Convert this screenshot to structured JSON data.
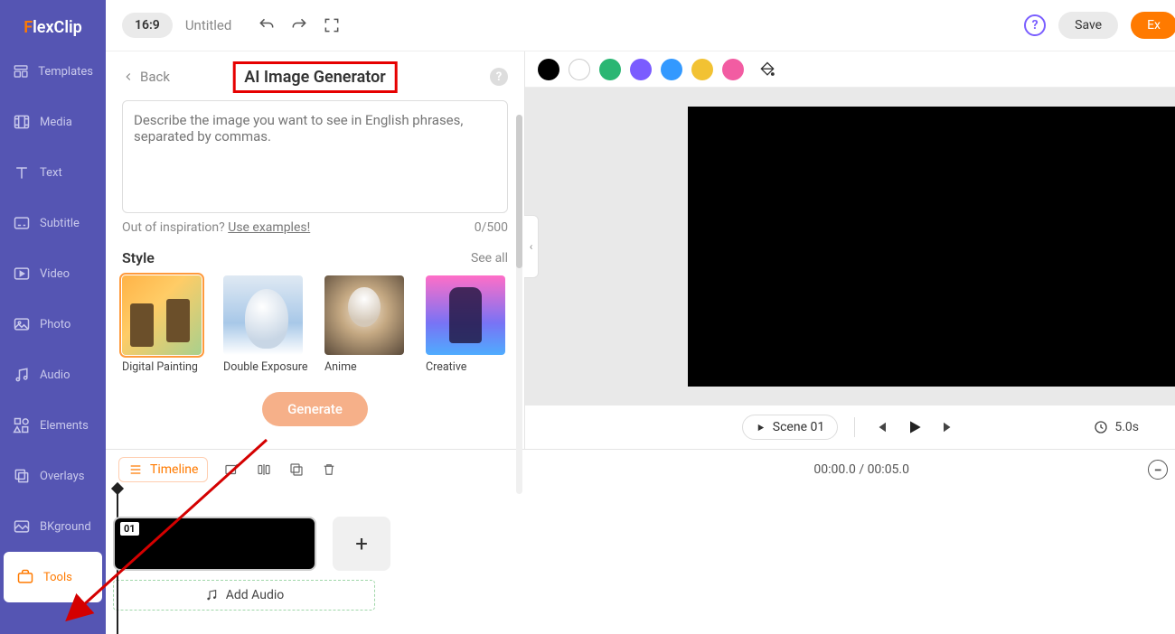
{
  "brand": {
    "part1": "F",
    "part2": "lexClip"
  },
  "sidebar": {
    "items": [
      {
        "label": "Templates"
      },
      {
        "label": "Media"
      },
      {
        "label": "Text"
      },
      {
        "label": "Subtitle"
      },
      {
        "label": "Video"
      },
      {
        "label": "Photo"
      },
      {
        "label": "Audio"
      },
      {
        "label": "Elements"
      },
      {
        "label": "Overlays"
      },
      {
        "label": "BKground"
      },
      {
        "label": "Tools"
      }
    ]
  },
  "topbar": {
    "ratio": "16:9",
    "title": "Untitled",
    "save": "Save",
    "export": "Ex"
  },
  "panel": {
    "back": "Back",
    "title": "AI Image Generator",
    "placeholder": "Describe the image you want to see in English phrases, separated by commas.",
    "inspiration": "Out of inspiration? ",
    "use_examples": "Use examples!",
    "counter": "0/500",
    "style_label": "Style",
    "see_all": "See all",
    "styles": [
      {
        "name": "Digital Painting"
      },
      {
        "name": "Double Exposure"
      },
      {
        "name": "Anime"
      },
      {
        "name": "Creative"
      }
    ],
    "generate": "Generate"
  },
  "colors": [
    "#000000",
    "#ffffff",
    "#2ab673",
    "#7a5cff",
    "#3399ff",
    "#f2c233",
    "#f25ca2"
  ],
  "player": {
    "scene_label": "Scene 01",
    "duration": "5.0s"
  },
  "timeline": {
    "button": "Timeline",
    "time": "00:00.0 / 00:05.0",
    "clip_num": "01",
    "add_audio": "Add Audio"
  }
}
